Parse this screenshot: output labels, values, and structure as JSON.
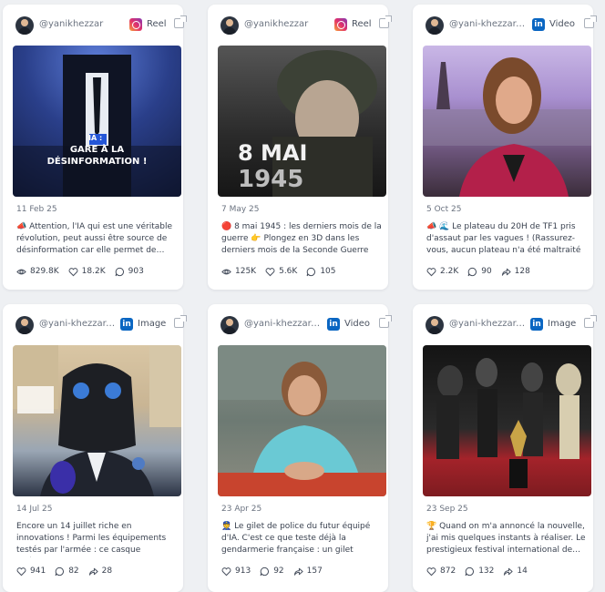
{
  "cards": [
    {
      "handle": "@yanikhezzar",
      "network": "instagram",
      "type_label": "Reel",
      "thumb_caption_1": "IA :",
      "thumb_caption_2": "GARE À LA",
      "thumb_caption_3": "DÉSINFORMATION !",
      "date": "11 Feb 25",
      "text": "📣 Attention, l'IA qui est une véritable révolution, peut aussi être source de désinformation car elle permet de…",
      "stats": {
        "views": "829.8K",
        "likes": "18.2K",
        "comments": "903"
      }
    },
    {
      "handle": "@yanikhezzar",
      "network": "instagram",
      "type_label": "Reel",
      "thumb_caption_1": "8 MAI",
      "thumb_caption_2": "1945",
      "date": "7 May 25",
      "text": "🔴 8 mai 1945 : les derniers mois de la guerre 👉 Plongez en 3D dans les derniers mois de la Seconde Guerre mondiale…",
      "stats": {
        "views": "125K",
        "likes": "5.6K",
        "comments": "105"
      }
    },
    {
      "handle": "@yani-khezzar-…",
      "network": "linkedin",
      "type_label": "Video",
      "date": "5 Oct 25",
      "text": "📣 🌊 Le plateau du 20H de TF1 pris d'assaut par les vagues ! (Rassurez-vous, aucun plateau n'a été maltraité pour…",
      "stats": {
        "likes": "2.2K",
        "comments": "90",
        "shares": "128"
      }
    },
    {
      "handle": "@yani-khezzar-…",
      "network": "linkedin",
      "type_label": "Image",
      "date": "14 Jul 25",
      "text": "Encore un 14 juillet riche en innovations ! Parmi les équipements testés par l'armée : ce casque intégral, pare-balles,…",
      "stats": {
        "likes": "941",
        "comments": "82",
        "shares": "28"
      }
    },
    {
      "handle": "@yani-khezzar-…",
      "network": "linkedin",
      "type_label": "Video",
      "date": "23 Apr 25",
      "text": "👮 Le gilet de police du futur équipé d'IA. C'est ce que teste déjà la gendarmerie française : un gilet intelligent capable de…",
      "stats": {
        "likes": "913",
        "comments": "92",
        "shares": "157"
      }
    },
    {
      "handle": "@yani-khezzar-…",
      "network": "linkedin",
      "type_label": "Image",
      "date": "23 Sep 25",
      "text": "🏆 Quand on m'a annoncé la nouvelle, j'ai mis quelques instants à réaliser. Le prestigieux festival international de…",
      "stats": {
        "likes": "872",
        "comments": "132",
        "shares": "14"
      }
    }
  ],
  "colors": {
    "background": "#eef0f3",
    "card": "#ffffff",
    "linkedin": "#0a66c2",
    "text": "#3a4250",
    "muted": "#6b7380"
  }
}
